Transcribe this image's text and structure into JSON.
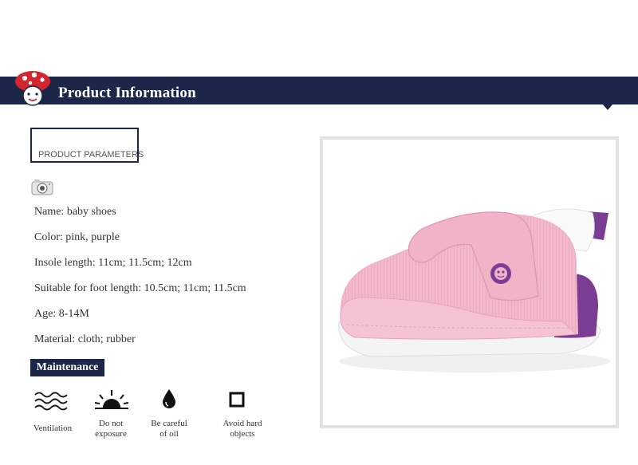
{
  "header": {
    "title": "Product Information"
  },
  "params": {
    "label": "PRODUCT PARAMETERS",
    "specs": [
      "Name: baby shoes",
      "Color: pink, purple",
      "Insole length: 11cm; 11.5cm; 12cm",
      "Suitable for foot length: 10.5cm; 11cm; 11.5cm",
      "Age: 8-14M",
      "Material: cloth; rubber"
    ]
  },
  "maintenance": {
    "title": "Maintenance",
    "items": [
      {
        "icon": "waves-icon",
        "line1": "Ventilation",
        "line2": ""
      },
      {
        "icon": "sun-icon",
        "line1": "Do not",
        "line2": "exposure"
      },
      {
        "icon": "drop-icon",
        "line1": "Be careful",
        "line2": "of oil"
      },
      {
        "icon": "square-icon",
        "line1": "Avoid hard",
        "line2": "objects"
      }
    ]
  },
  "colors": {
    "banner": "#1c2648",
    "shoe_pink": "#f2b6c9",
    "shoe_purple": "#7b3c93"
  }
}
